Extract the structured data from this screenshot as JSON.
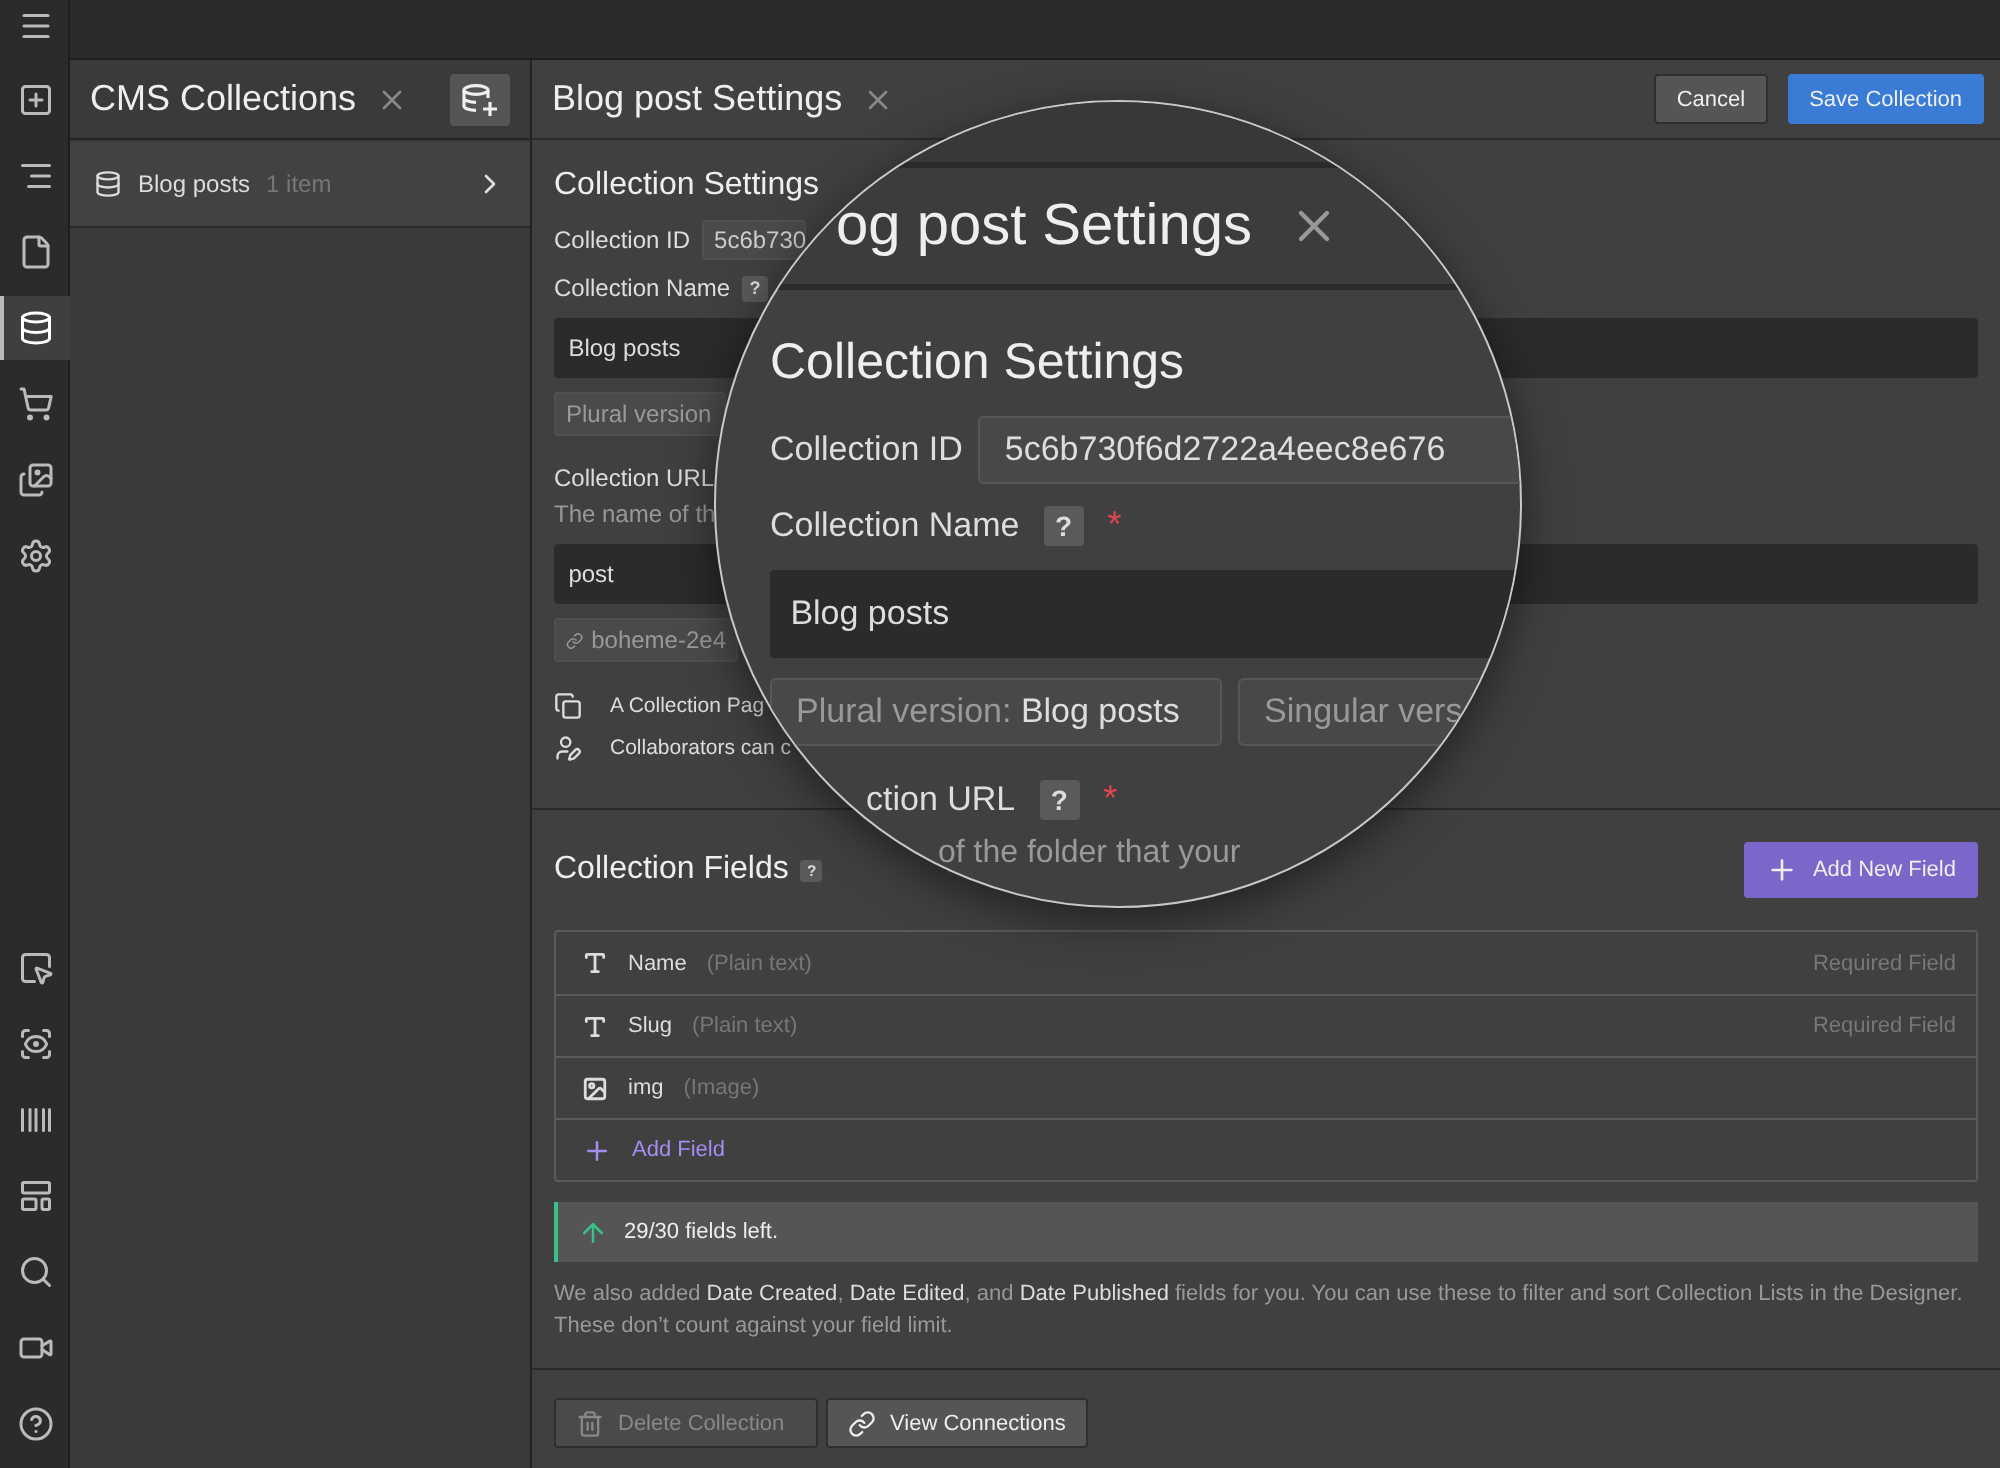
{
  "toolbar": {
    "top": [
      {
        "kind": "add",
        "selected": false
      },
      {
        "kind": "navigator",
        "selected": false
      },
      {
        "kind": "pages",
        "selected": false
      },
      {
        "kind": "cms",
        "selected": true
      },
      {
        "kind": "ecommerce",
        "selected": false
      },
      {
        "kind": "assets",
        "selected": false
      },
      {
        "kind": "settings",
        "selected": false
      }
    ],
    "bottom": [
      {
        "kind": "select",
        "selected": false
      },
      {
        "kind": "preview",
        "selected": false
      },
      {
        "kind": "barcode",
        "selected": false
      },
      {
        "kind": "layout",
        "selected": false
      },
      {
        "kind": "search",
        "selected": false
      },
      {
        "kind": "video",
        "selected": false
      },
      {
        "kind": "help",
        "selected": false
      }
    ]
  },
  "collections_panel": {
    "title": "CMS Collections",
    "items": [
      {
        "name": "Blog posts",
        "count": "1 item",
        "selected": false
      }
    ]
  },
  "settings": {
    "title": "Blog post Settings",
    "cancel": "Cancel",
    "save": "Save Collection",
    "section_title": "Collection Settings",
    "id_label": "Collection ID",
    "id_value": "5c6b730",
    "name_label": "Collection Name",
    "help": "?",
    "name_value": "Blog posts",
    "plural": "Plural version",
    "url_label": "Collection URL",
    "url_hint": "The name of th",
    "url_value": "post",
    "link": "boheme-2e4",
    "notes": [
      {
        "kind": "pages",
        "text": "A Collection Pag"
      },
      {
        "kind": "collaborators",
        "text": "Collaborators can c"
      }
    ]
  },
  "magnifier": {
    "title": "og post Settings",
    "section_title": "Collection Settings",
    "id_label": "Collection ID",
    "id_value": "5c6b730f6d2722a4eec8e676",
    "name_label": "Collection Name",
    "help": "?",
    "required_mark": "*",
    "name_value": "Blog posts",
    "plural": "Plural version: **Blog posts**",
    "singular": "Singular vers",
    "url_label": "ction URL",
    "url_help": "?",
    "url_required_mark": "*",
    "url_hint": "of the folder that your"
  },
  "fields_section": {
    "title": "Collection Fields",
    "help": "?",
    "add_button": "Add New Field",
    "fields": [
      {
        "kind": "text",
        "name": "Name",
        "type": "(Plain text)",
        "note": "Required Field"
      },
      {
        "kind": "text",
        "name": "Slug",
        "type": "(Plain text)",
        "note": "Required Field"
      },
      {
        "kind": "image",
        "name": "img",
        "type": "(Image)"
      }
    ],
    "add_field": "Add Field",
    "limit": "29/30 fields left.",
    "info": "We also added **Date Created**, **Date Edited**, and **Date Published** fields for you. You can use these to filter and sort Collection Lists in the Designer. These don’t count against your field limit."
  },
  "footer": {
    "delete": {
      "label": "Delete Collection",
      "disabled": true
    },
    "view": "View Connections"
  }
}
